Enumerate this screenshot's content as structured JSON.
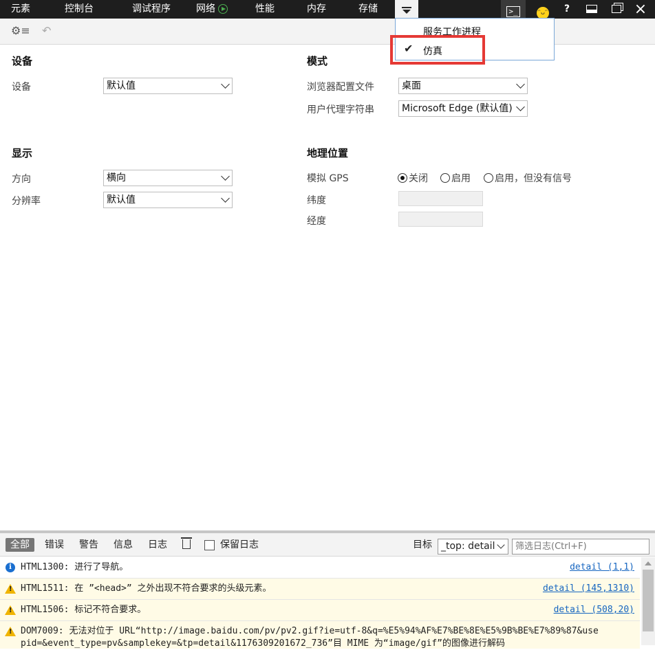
{
  "tabs": [
    {
      "label": "元素"
    },
    {
      "label": "控制台"
    },
    {
      "label": "调试程序"
    },
    {
      "label": "网络"
    },
    {
      "label": "性能"
    },
    {
      "label": "内存"
    },
    {
      "label": "存储"
    }
  ],
  "menu": {
    "items": [
      "服务工作进程",
      "仿真"
    ],
    "checked_mark": "✔"
  },
  "top_icons": {
    "console": ">_",
    "help": "?",
    "close": "×"
  },
  "device": {
    "heading": "设备",
    "device_label": "设备",
    "device_value": "默认值"
  },
  "mode": {
    "heading": "模式",
    "browser_profile_label": "浏览器配置文件",
    "browser_profile_value": "桌面",
    "user_agent_label": "用户代理字符串",
    "user_agent_value": "Microsoft Edge (默认值)"
  },
  "display": {
    "heading": "显示",
    "orientation_label": "方向",
    "orientation_value": "横向",
    "resolution_label": "分辨率",
    "resolution_value": "默认值"
  },
  "geo": {
    "heading": "地理位置",
    "gps_label": "模拟 GPS",
    "radio_off": "关闭",
    "radio_on": "启用",
    "radio_no_signal": "启用，但没有信号",
    "selected": "关闭",
    "latitude_label": "纬度",
    "longitude_label": "经度"
  },
  "console": {
    "filters": [
      "全部",
      "错误",
      "警告",
      "信息",
      "日志"
    ],
    "active_filter": "全部",
    "preserve_log_label": "保留日志",
    "target_label": "目标",
    "target_value": "_top: detail",
    "filter_placeholder": "筛选日志(Ctrl+F)",
    "messages": [
      {
        "level": "info",
        "text": "HTML1300: 进行了导航。",
        "link": "detail (1,1)"
      },
      {
        "level": "warning",
        "text": "HTML1511: 在 ”<head>” 之外出现不符合要求的头级元素。",
        "link": "detail (145,1310)"
      },
      {
        "level": "warning",
        "text": "HTML1506: 标记不符合要求。",
        "link": "detail (508,20)"
      },
      {
        "level": "warning",
        "text": "DOM7009: 无法对位于 URL“http://image.baidu.com/pv/pv2.gif?ie=utf-8&q=%E5%94%AF%E7%BE%8E%E5%9B%BE%E7%89%87&use",
        "link": ""
      }
    ],
    "partial_line": "pid=&event_type=pv&samplekey=&tp=detail&1176309201672_736”目 MIME 为“image/gif”的图像进行解码"
  },
  "colors": {
    "accent_red": "#e53935",
    "topbar": "#1e1e1e",
    "link": "#1565c0",
    "warning_bg": "#fffbe6"
  }
}
